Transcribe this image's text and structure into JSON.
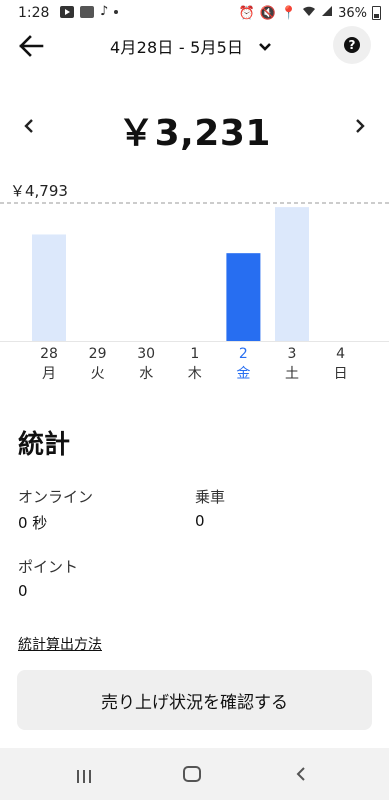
{
  "status_bar": {
    "time": "1:28",
    "battery": "36%",
    "icons": [
      "youtube-icon",
      "news-icon",
      "tiktok-icon",
      "notification-dot-icon",
      "alarm-icon",
      "mute-icon",
      "location-icon",
      "wifi-icon",
      "volte-icon",
      "signal-icon",
      "battery-icon"
    ]
  },
  "header": {
    "date_range": "4月28日 - 5月5日",
    "help_symbol": "?"
  },
  "summary": {
    "total": "￥3,231"
  },
  "chart_data": {
    "type": "bar",
    "categories": [
      "28",
      "29",
      "30",
      "1",
      "2",
      "3",
      "4"
    ],
    "weekdays": [
      "月",
      "火",
      "水",
      "木",
      "金",
      "土",
      "日"
    ],
    "values": [
      3700,
      0,
      0,
      0,
      3050,
      4650,
      0
    ],
    "selected_index": 4,
    "max_label": "￥4,793",
    "ylim": [
      0,
      4793
    ],
    "colors": {
      "default": "#dce8fb",
      "selected": "#276ef1",
      "reference_line": "#999999"
    }
  },
  "stats": {
    "title": "統計",
    "items": [
      {
        "label": "オンライン",
        "value": "0 秒"
      },
      {
        "label": "乗車",
        "value": "0"
      },
      {
        "label": "ポイント",
        "value": "0"
      }
    ],
    "method_link": "統計算出方法"
  },
  "actions": {
    "confirm_label": "売り上げ状況を確認する"
  }
}
